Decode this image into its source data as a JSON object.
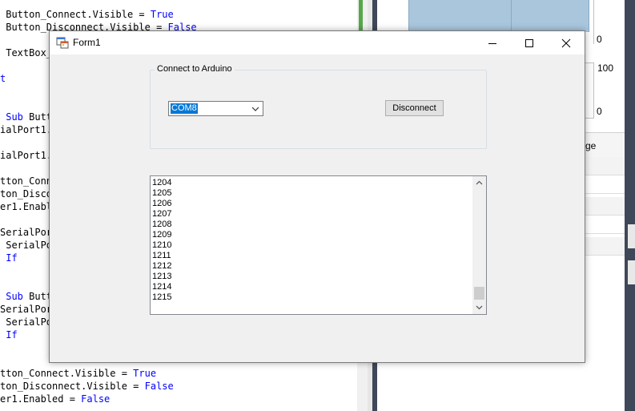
{
  "editor": {
    "lines": [
      {
        "tokens": [
          {
            "t": " Button_Connect.Visible = ",
            "c": "plain"
          },
          {
            "t": "True",
            "c": "kw"
          }
        ]
      },
      {
        "tokens": [
          {
            "t": " Button_Disconnect.Visible = ",
            "c": "plain"
          },
          {
            "t": "False",
            "c": "kw"
          }
        ]
      },
      {
        "tokens": []
      },
      {
        "tokens": [
          {
            "t": " TextBox_",
            "c": "plain"
          }
        ]
      },
      {
        "tokens": []
      },
      {
        "tokens": [
          {
            "t": "t",
            "c": "kw"
          }
        ]
      },
      {
        "tokens": []
      },
      {
        "tokens": []
      },
      {
        "tokens": [
          {
            "t": " ",
            "c": "plain"
          },
          {
            "t": "Sub",
            "c": "kw"
          },
          {
            "t": " Butt",
            "c": "plain"
          }
        ]
      },
      {
        "tokens": [
          {
            "t": "ialPort1.",
            "c": "plain"
          }
        ]
      },
      {
        "tokens": []
      },
      {
        "tokens": [
          {
            "t": "ialPort1.",
            "c": "plain"
          }
        ]
      },
      {
        "tokens": []
      },
      {
        "tokens": [
          {
            "t": "tton_Conne",
            "c": "plain"
          }
        ]
      },
      {
        "tokens": [
          {
            "t": "ton_Disco",
            "c": "plain"
          }
        ]
      },
      {
        "tokens": [
          {
            "t": "er1.Enabl",
            "c": "plain"
          }
        ]
      },
      {
        "tokens": []
      },
      {
        "tokens": [
          {
            "t": "SerialPor",
            "c": "plain"
          }
        ]
      },
      {
        "tokens": [
          {
            "t": " SerialPo",
            "c": "plain"
          }
        ]
      },
      {
        "tokens": [
          {
            "t": " ",
            "c": "plain"
          },
          {
            "t": "If",
            "c": "kw"
          }
        ]
      },
      {
        "tokens": []
      },
      {
        "tokens": []
      },
      {
        "tokens": [
          {
            "t": " ",
            "c": "plain"
          },
          {
            "t": "Sub",
            "c": "kw"
          },
          {
            "t": " Butt",
            "c": "plain"
          }
        ]
      },
      {
        "tokens": [
          {
            "t": "SerialPor",
            "c": "plain"
          }
        ]
      },
      {
        "tokens": [
          {
            "t": " SerialPo",
            "c": "plain"
          }
        ]
      },
      {
        "tokens": [
          {
            "t": " ",
            "c": "plain"
          },
          {
            "t": "If",
            "c": "kw"
          }
        ]
      },
      {
        "tokens": []
      },
      {
        "tokens": []
      },
      {
        "tokens": [
          {
            "t": "tton_Connect.Visible = ",
            "c": "plain"
          },
          {
            "t": "True",
            "c": "kw"
          }
        ]
      },
      {
        "tokens": [
          {
            "t": "ton_Disconnect.Visible = ",
            "c": "plain"
          },
          {
            "t": "False",
            "c": "kw"
          }
        ]
      },
      {
        "tokens": [
          {
            "t": "er1.Enabled = ",
            "c": "plain"
          },
          {
            "t": "False",
            "c": "kw"
          }
        ]
      }
    ]
  },
  "designer": {
    "axis_top_label": "0",
    "gauge_max_label": "100",
    "gauge_min_label": "0",
    "props_partial_text": "ge"
  },
  "window": {
    "title": "Form1",
    "icons": {
      "app": "form-icon",
      "minimize": "minimize-icon",
      "maximize": "maximize-icon",
      "close": "close-icon"
    }
  },
  "groupbox": {
    "label": "Connect to Arduino"
  },
  "combo": {
    "selected": "COM8"
  },
  "buttons": {
    "disconnect": "Disconnect"
  },
  "textbox": {
    "lines": [
      "1204",
      "1205",
      "1206",
      "1207",
      "1208",
      "1209",
      "1210",
      "1211",
      "1212",
      "1213",
      "1214",
      "1215"
    ]
  },
  "colors": {
    "selection": "#0078d7",
    "keyword": "#0000ff",
    "form_bg": "#f0f0f0"
  }
}
